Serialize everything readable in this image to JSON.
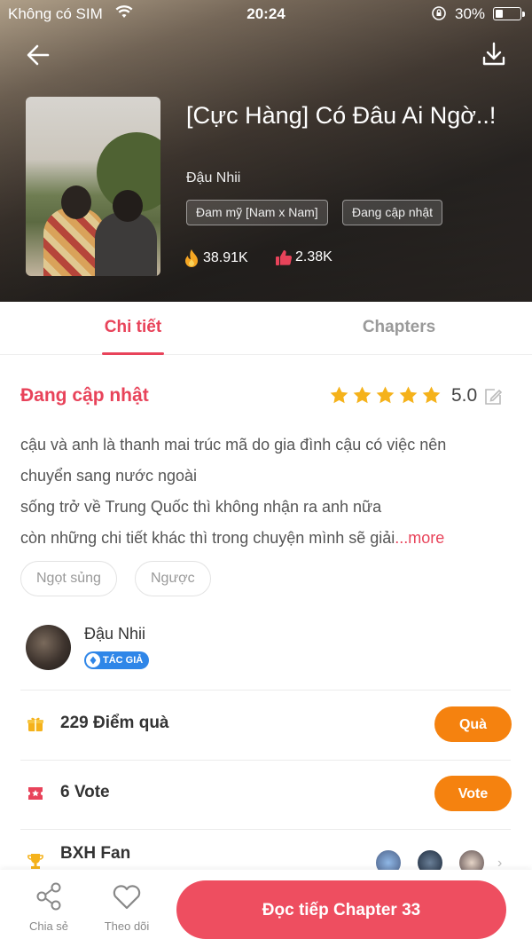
{
  "status_bar": {
    "carrier": "Không có SIM",
    "time": "20:24",
    "battery_percent": "30%",
    "battery_level": 0.3
  },
  "header": {
    "back_icon": "arrow-left-icon",
    "download_icon": "download-icon",
    "title": "[Cực Hàng] Có Đâu Ai Ngờ..!",
    "author": "Đậu Nhii",
    "tags": [
      "Đam mỹ [Nam x Nam]",
      "Đang cập nhật"
    ],
    "views": "38.91K",
    "likes": "2.38K"
  },
  "tabs": {
    "details": "Chi tiết",
    "chapters": "Chapters",
    "active": "details"
  },
  "details": {
    "status": "Đang cập nhật",
    "stars": 5,
    "rating": "5.0",
    "description": {
      "line1": "cậu và anh là thanh mai trúc mã do gia đình cậu có việc nên",
      "line2": "chuyển sang nước ngoài",
      "line3": " sống trở về Trung Quốc thì không nhận ra anh nữa",
      "line4": "còn những chi tiết khác thì trong chuyện mình sẽ giải",
      "more": "...more"
    },
    "genres": [
      "Ngọt sủng",
      "Ngược"
    ]
  },
  "author_block": {
    "name": "Đậu Nhii",
    "badge": "TÁC GIẢ"
  },
  "gifts": {
    "label": "229 Điểm quà",
    "button": "Quà",
    "icon": "gift-icon"
  },
  "votes": {
    "label": "6 Vote",
    "button": "Vote",
    "icon": "ticket-icon"
  },
  "fans": {
    "label": "BXH Fan",
    "icon": "trophy-icon"
  },
  "bottom_bar": {
    "share": "Chia sẻ",
    "follow": "Theo dõi",
    "read_continue": "Đọc tiếp Chapter 33"
  },
  "colors": {
    "accent": "#e8435a",
    "orange": "#f5820f",
    "cta": "#ee4e60",
    "star": "#f5b21b"
  }
}
